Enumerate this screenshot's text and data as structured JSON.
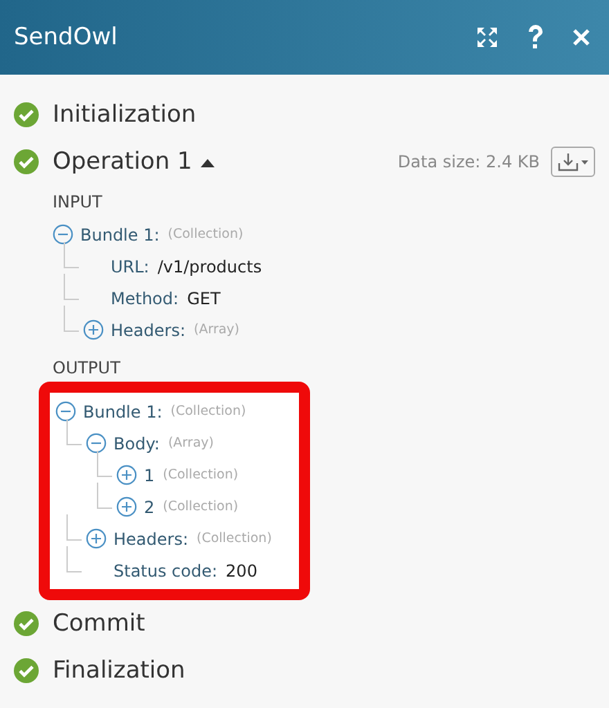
{
  "window": {
    "title": "SendOwl"
  },
  "steps": [
    {
      "label": "Initialization",
      "done": true
    },
    {
      "label": "Operation 1",
      "done": true,
      "expanded": true,
      "data_size": "Data size: 2.4 KB",
      "sections": [
        {
          "title": "INPUT",
          "highlighted": false,
          "tree": [
            {
              "label": "Bundle 1:",
              "type": "(Collection)",
              "expanded": true,
              "children": [
                {
                  "label": "URL:",
                  "value": "/v1/products"
                },
                {
                  "label": "Method:",
                  "value": "GET"
                },
                {
                  "label": "Headers:",
                  "type": "(Array)",
                  "expanded": false
                }
              ]
            }
          ]
        },
        {
          "title": "OUTPUT",
          "highlighted": true,
          "tree": [
            {
              "label": "Bundle 1:",
              "type": "(Collection)",
              "expanded": true,
              "children": [
                {
                  "label": "Body:",
                  "type": "(Array)",
                  "expanded": true,
                  "children": [
                    {
                      "label": "1",
                      "type": "(Collection)",
                      "expanded": false
                    },
                    {
                      "label": "2",
                      "type": "(Collection)",
                      "expanded": false
                    }
                  ]
                },
                {
                  "label": "Headers:",
                  "type": "(Collection)",
                  "expanded": false
                },
                {
                  "label": "Status code:",
                  "value": "200"
                }
              ]
            }
          ]
        }
      ]
    },
    {
      "label": "Commit",
      "done": true
    },
    {
      "label": "Finalization",
      "done": true
    }
  ]
}
